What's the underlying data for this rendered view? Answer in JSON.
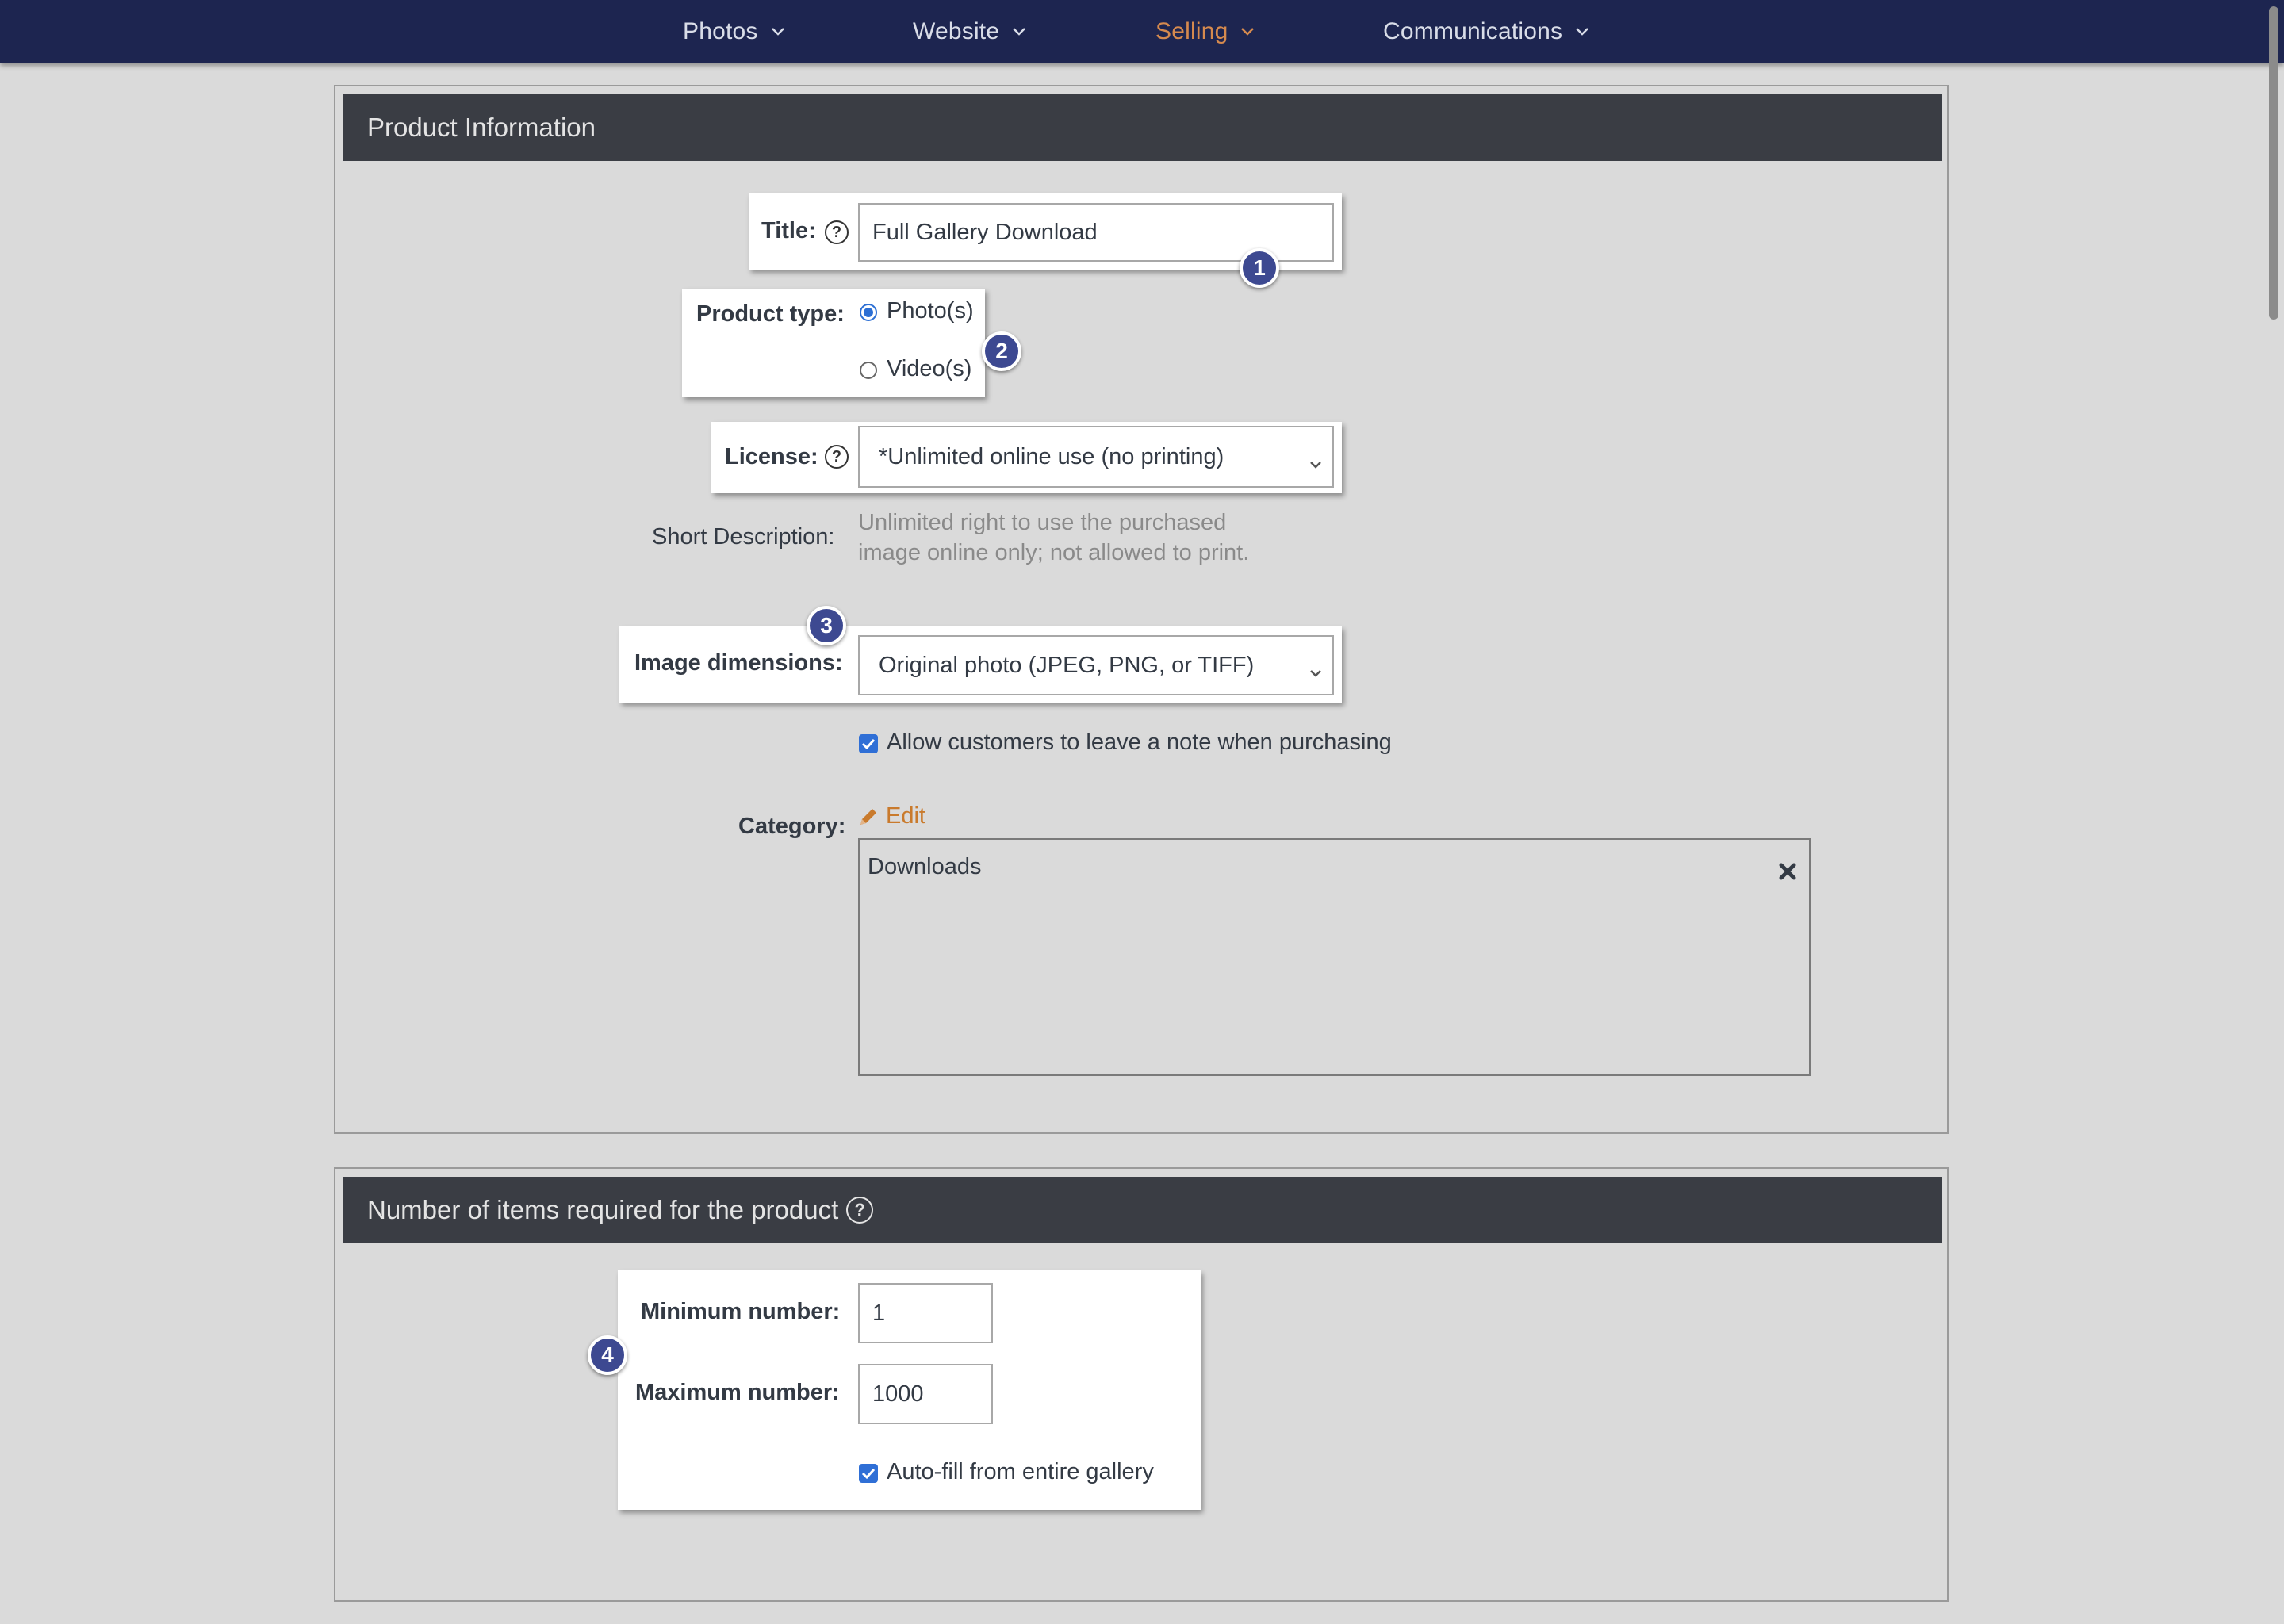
{
  "nav": {
    "items": [
      {
        "label": "Photos"
      },
      {
        "label": "Website"
      },
      {
        "label": "Selling",
        "active": true
      },
      {
        "label": "Communications"
      }
    ],
    "active_color": "#d68a4e",
    "background": "#1d2550"
  },
  "product_info": {
    "heading": "Product Information",
    "title": {
      "label": "Title:",
      "value": "Full Gallery Download",
      "help_icon": "question-circle-icon"
    },
    "product_type": {
      "label": "Product type:",
      "options": [
        {
          "label": "Photo(s)",
          "selected": true
        },
        {
          "label": "Video(s)",
          "selected": false
        }
      ]
    },
    "license": {
      "label": "License:",
      "value": "*Unlimited online use (no printing)"
    },
    "short_description": {
      "label": "Short Description:",
      "line1": "Unlimited right to use the purchased",
      "line2": "image online only; not allowed to print."
    },
    "image_dimensions": {
      "label": "Image dimensions:",
      "value": "Original photo (JPEG, PNG, or TIFF)"
    },
    "allow_note": {
      "label": "Allow customers to leave a note when purchasing",
      "checked": true
    },
    "category": {
      "label": "Category:",
      "edit_label": "Edit",
      "items": [
        "Downloads"
      ]
    }
  },
  "items_required": {
    "heading": "Number of items required for the product",
    "minimum": {
      "label": "Minimum number:",
      "value": "1"
    },
    "maximum": {
      "label": "Maximum number:",
      "value": "1000"
    },
    "autofill": {
      "label": "Auto-fill from entire gallery",
      "checked": true
    }
  },
  "callouts": [
    "1",
    "2",
    "3",
    "4"
  ],
  "colors": {
    "accent_blue": "#2f6fd6",
    "callout": "#3d4991",
    "panel_header": "#3a3d44",
    "link": "#c97a2c"
  }
}
